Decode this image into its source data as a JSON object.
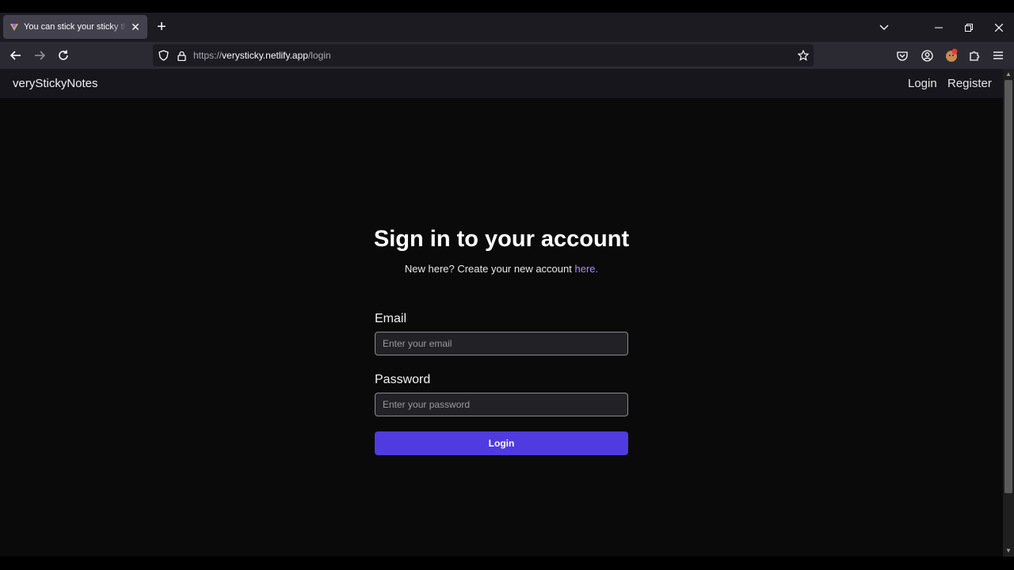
{
  "browser": {
    "tab_title": "You can stick your sticky things here",
    "tab_close_glyph": "✕",
    "new_tab_glyph": "+",
    "url_scheme": "https://",
    "url_host": "verysticky.netlify.app",
    "url_path": "/login"
  },
  "site_header": {
    "brand": "veryStickyNotes",
    "login_link": "Login",
    "register_link": "Register"
  },
  "login_form": {
    "heading": "Sign in to your account",
    "subtext": "New here? Create your new account ",
    "subtext_link": "here.",
    "email_label": "Email",
    "email_placeholder": "Enter your email",
    "password_label": "Password",
    "password_placeholder": "Enter your password",
    "submit_label": "Login"
  },
  "colors": {
    "page_background": "#0b0a0a",
    "accent_button": "#4f3be0",
    "link": "#a78bfa"
  }
}
